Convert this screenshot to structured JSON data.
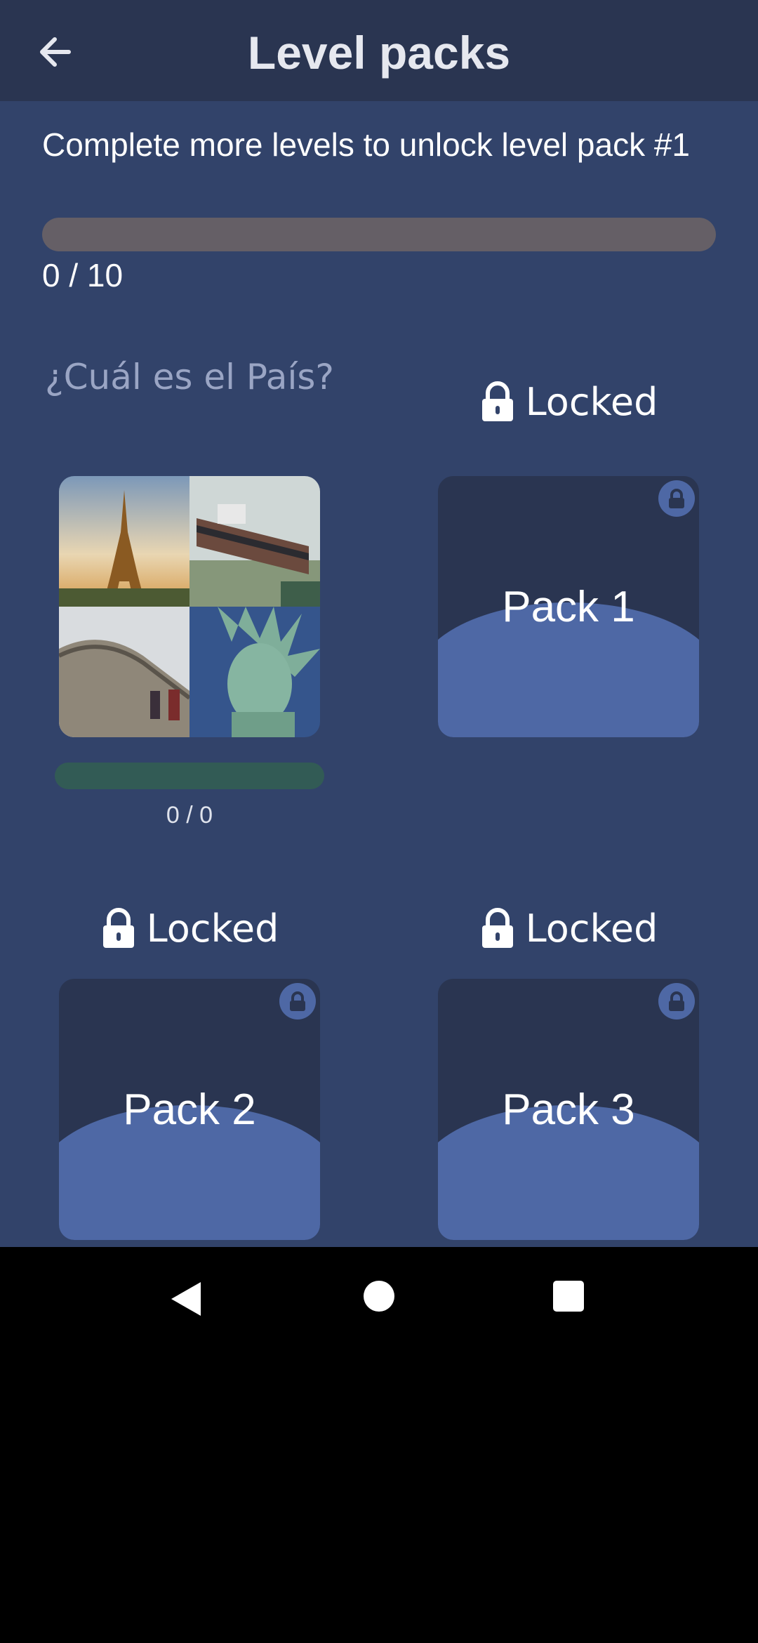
{
  "header": {
    "title": "Level packs",
    "back_icon": "arrow-left-icon"
  },
  "unlock": {
    "message": "Complete more levels to unlock level pack #1",
    "progress_fraction": 0,
    "count_text": "0 / 10"
  },
  "featured_pack": {
    "title": "¿Cuál es el País?",
    "progress_fraction": 0,
    "count_text": "0 / 0"
  },
  "packs": [
    {
      "status": "Locked",
      "label": "Pack 1"
    },
    {
      "status": "Locked",
      "label": "Pack 2"
    },
    {
      "status": "Locked",
      "label": "Pack 3"
    }
  ],
  "colors": {
    "background": "#32436a",
    "topbar": "#2a3551",
    "accent": "#4e68a5",
    "progress_track": "#655f66",
    "pack_progress_track": "#325b55"
  },
  "system_nav": {
    "back_icon": "triangle-back-icon",
    "home_icon": "circle-home-icon",
    "recents_icon": "square-recents-icon"
  }
}
